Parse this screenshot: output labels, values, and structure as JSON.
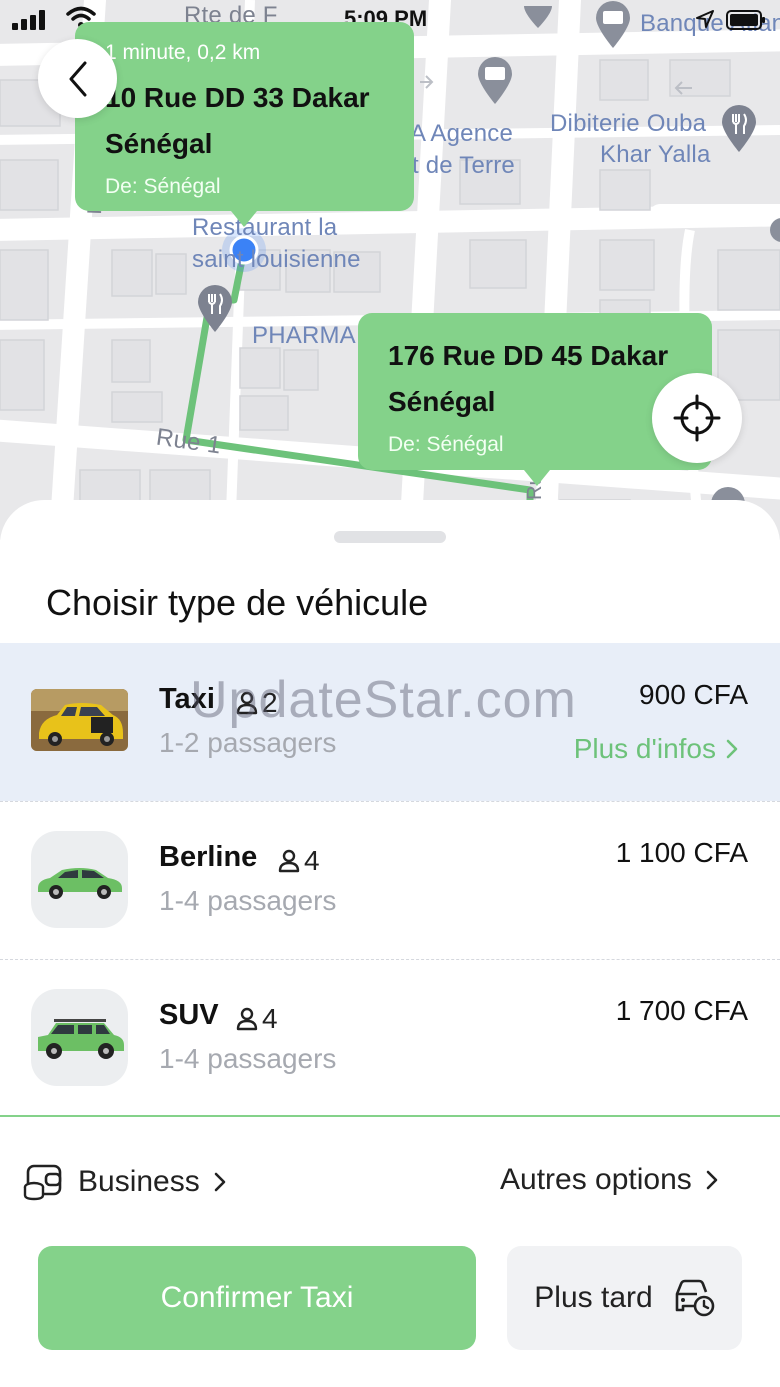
{
  "status_bar": {
    "time": "5:09 PM"
  },
  "map": {
    "labels": {
      "street_top": "Rte de F",
      "bank": "Banque Atlant",
      "agence_line1": "A Agence",
      "agence_line2": "t de Terre",
      "dibiterie_line1": "Dibiterie Ouba",
      "dibiterie_line2": "Khar Yalla",
      "restaurant_line1": "Restaurant la",
      "restaurant_line2": "saint louisienne",
      "pharma": "PHARMA",
      "rue1": "Rue 1",
      "ru_left": "Ru",
      "ru_bottom": "Ru"
    },
    "origin_bubble": {
      "eta": "1 minute, 0,2 km",
      "address_line1": "10 Rue DD 33 Dakar",
      "address_line2": "Sénégal",
      "from": "De: Sénégal"
    },
    "destination_bubble": {
      "address_line1": "176 Rue DD 45 Dakar",
      "address_line2": "Sénégal",
      "from": "De: Sénégal"
    }
  },
  "sheet": {
    "title": "Choisir type de véhicule",
    "watermark": "UpdateStar.com",
    "vehicles": [
      {
        "name": "Taxi",
        "capacity": "2",
        "passengers": "1-2 passagers",
        "price": "900 CFA",
        "more": "Plus d'infos",
        "selected": true
      },
      {
        "name": "Berline",
        "capacity": "4",
        "passengers": "1-4 passagers",
        "price": "1 100 CFA"
      },
      {
        "name": "SUV",
        "capacity": "4",
        "passengers": "1-4 passagers",
        "price": "1 700 CFA"
      }
    ],
    "business_label": "Business",
    "other_options_label": "Autres options",
    "confirm_label": "Confirmer Taxi",
    "later_label": "Plus tard"
  },
  "colors": {
    "accent": "#84d28a",
    "accent_text": "#6dc27a",
    "selected_row": "#e8eef8",
    "map_bg": "#e8e8ea",
    "route": "#6dc27a",
    "user_dot": "#3b82f6"
  },
  "icons": [
    "signal-icon",
    "wifi-icon",
    "location-arrow-icon",
    "battery-icon",
    "back-chevron-icon",
    "crosshair-icon",
    "user-icon",
    "chevron-right-icon",
    "wallet-icon",
    "car-clock-icon",
    "restaurant-pin-icon",
    "atm-pin-icon"
  ]
}
